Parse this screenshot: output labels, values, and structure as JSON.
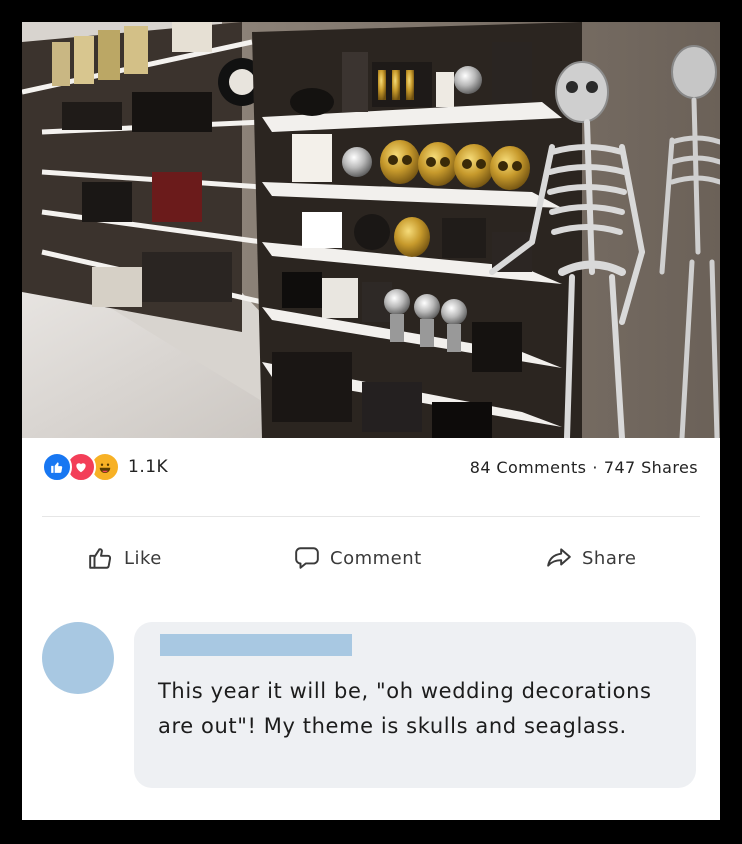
{
  "post": {
    "photo_label": "halloween-store-aisle-photo"
  },
  "reactions": {
    "icons": [
      "like-icon",
      "love-icon",
      "haha-icon"
    ],
    "count": "1.1K",
    "comments": "84 Comments",
    "separator": "·",
    "shares": "747 Shares"
  },
  "actions": {
    "like": "Like",
    "comment": "Comment",
    "share": "Share"
  },
  "comment": {
    "text": "This year it will be, \"oh wedding decorations are out\"! My theme is skulls and seaglass."
  },
  "colors": {
    "like_blue": "#1877f2",
    "love_red": "#f33e58",
    "haha_yellow": "#f7b125",
    "redaction_blue": "#a8c8e2",
    "bubble_bg": "#eef0f3"
  }
}
